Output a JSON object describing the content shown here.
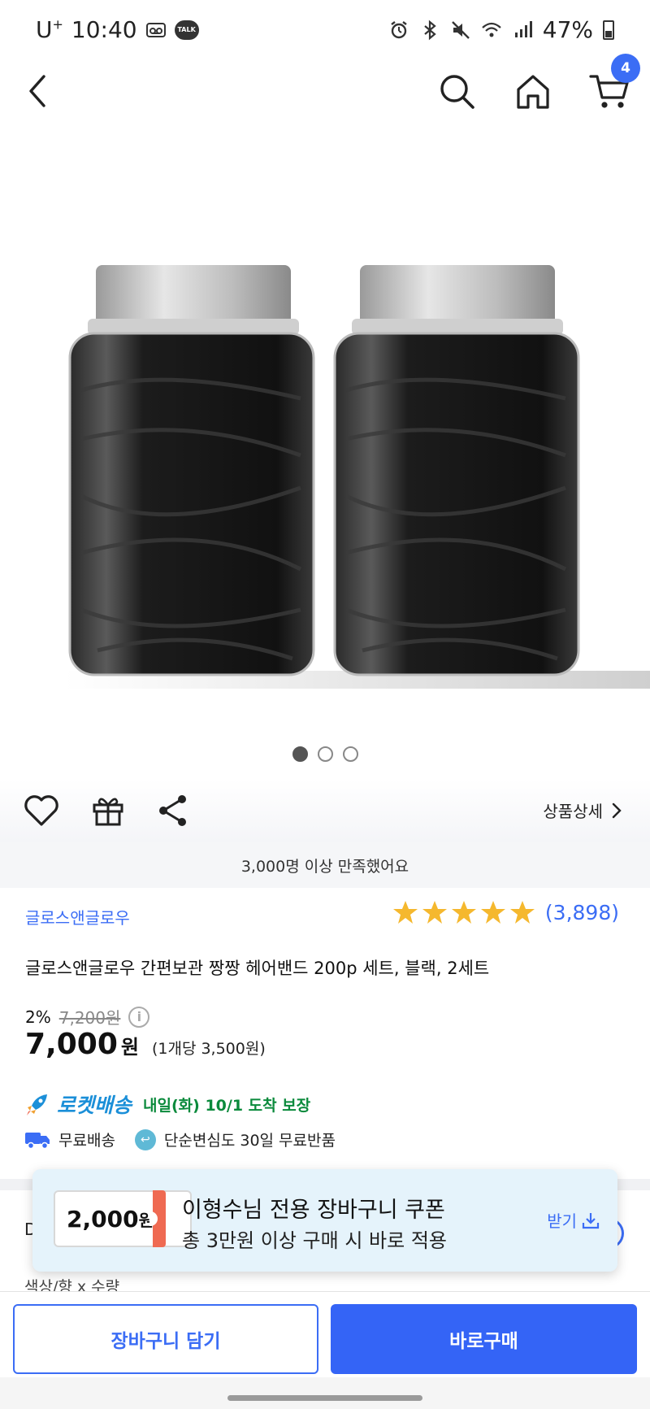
{
  "status_bar": {
    "carrier": "U",
    "carrier_sup": "+",
    "time": "10:40",
    "battery": "47%"
  },
  "nav": {
    "cart_count": "4"
  },
  "gallery": {
    "total": 3,
    "active_index": 0
  },
  "actions": {
    "detail_label": "상품상세"
  },
  "satisfaction_text": "3,000명 이상 만족했어요",
  "product": {
    "brand": "글로스앤글로우",
    "rating": 5,
    "review_count": "(3,898)",
    "title": "글로스앤글로우 간편보관 짱짱 헤어밴드 200p 세트, 블랙, 2세트",
    "discount": "2%",
    "original_price": "7,200원",
    "price": "7,000",
    "price_unit": "원",
    "unit_price": "(1개당 3,500원)"
  },
  "delivery": {
    "rocket_label": "로켓배송",
    "arrival": "내일(화) 10/1 도착 보장",
    "free_shipping": "무료배송",
    "free_return": "단순변심도 30일 무료반품"
  },
  "behind": {
    "partial_label": "D",
    "option_label": "색상/향 x 수량"
  },
  "coupon": {
    "amount": "2,000",
    "amount_unit": "원",
    "title": "이형수님 전용 장바구니 쿠폰",
    "subtitle": "총 3만원 이상 구매 시 바로 적용",
    "get_label": "받기"
  },
  "bottom": {
    "add_to_cart": "장바구니 담기",
    "buy_now": "바로구매"
  },
  "colors": {
    "accent": "#3464f6",
    "rocket": "#1b8fd8",
    "arrival": "#0b8a3c",
    "star": "#f5b82e",
    "coupon_bg": "#e5f3fb",
    "coupon_tab": "#ef6a52"
  }
}
